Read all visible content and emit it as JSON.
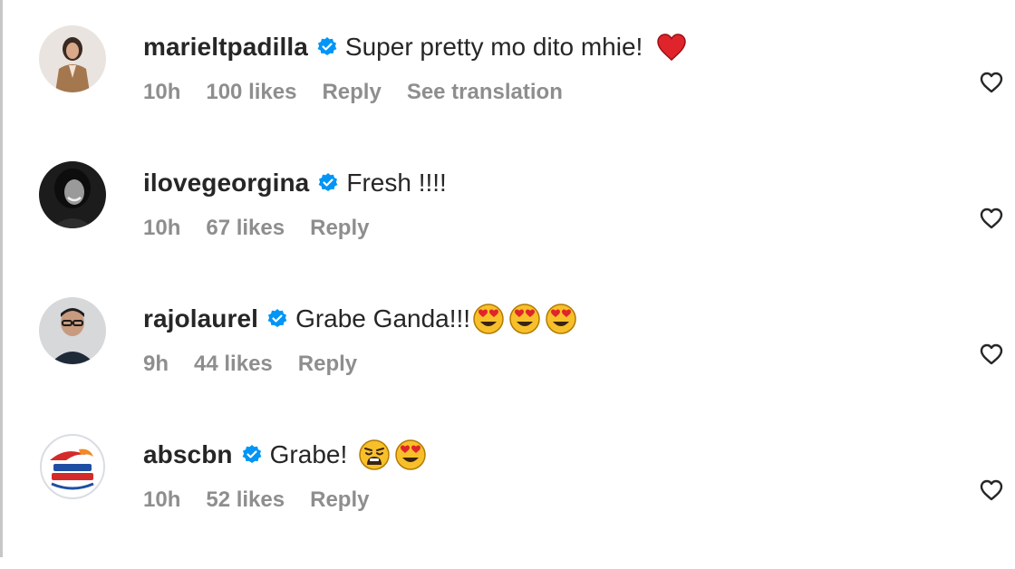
{
  "comments": [
    {
      "username": "marieltpadilla",
      "text": "Super pretty mo dito mhie!",
      "emojis": [
        "red-heart"
      ],
      "time": "10h",
      "likes": "100 likes",
      "reply": "Reply",
      "translation": "See translation"
    },
    {
      "username": "ilovegeorgina",
      "text": "Fresh !!!!",
      "emojis": [],
      "time": "10h",
      "likes": "67 likes",
      "reply": "Reply"
    },
    {
      "username": "rajolaurel",
      "text": "Grabe Ganda!!!",
      "emojis": [
        "heart-eyes",
        "heart-eyes",
        "heart-eyes"
      ],
      "time": "9h",
      "likes": "44 likes",
      "reply": "Reply"
    },
    {
      "username": "abscbn",
      "text": "Grabe!",
      "emojis": [
        "weary-face",
        "heart-eyes"
      ],
      "time": "10h",
      "likes": "52 likes",
      "reply": "Reply"
    }
  ],
  "colors": {
    "text": "#262626",
    "meta": "#8e8e8e",
    "verified": "#0095f6",
    "heart_emoji": "#e0242b",
    "emoji_face": "#f7c02a"
  }
}
